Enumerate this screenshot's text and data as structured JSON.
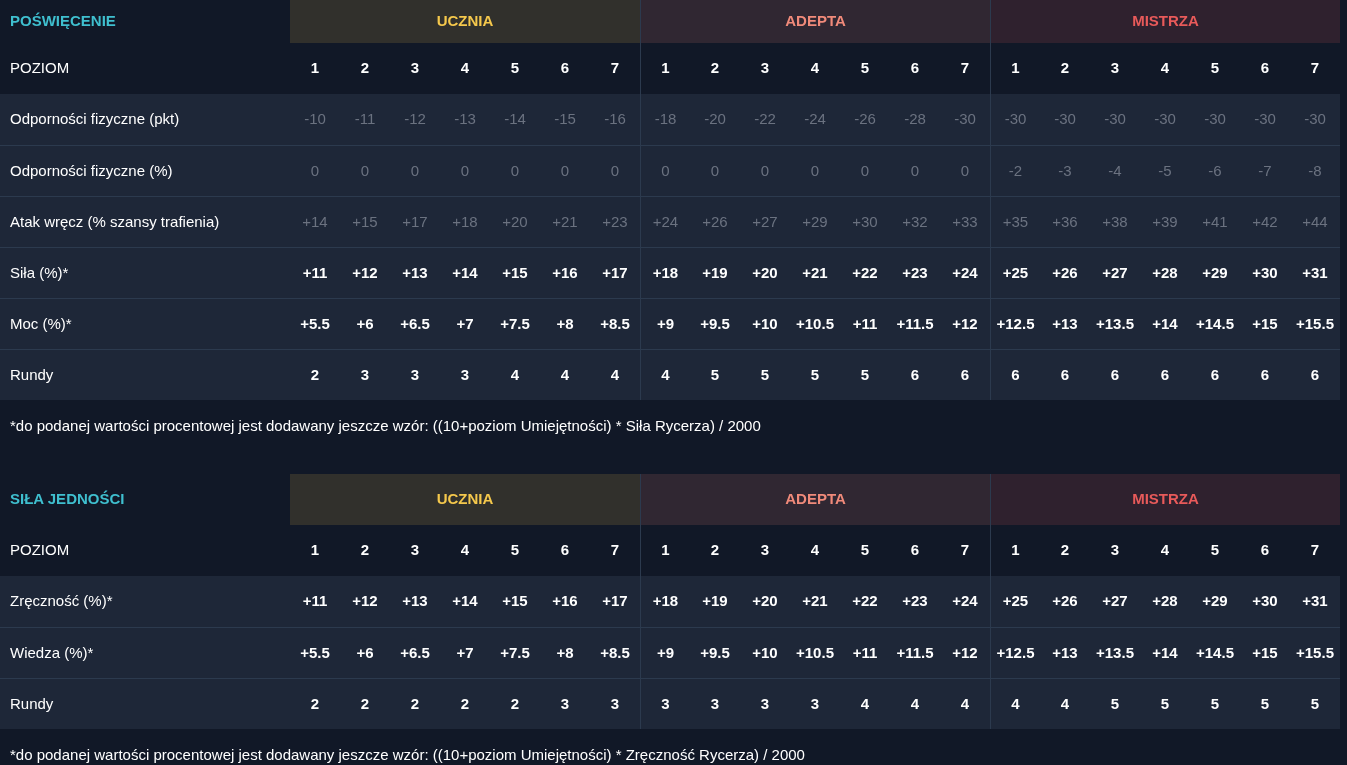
{
  "sections": [
    {
      "title": "POŚWIĘCENIE",
      "level_label": "POZIOM",
      "tiers": [
        {
          "name": "UCZNIA",
          "color": "#f5c84c",
          "levels": [
            "1",
            "2",
            "3",
            "4",
            "5",
            "6",
            "7"
          ]
        },
        {
          "name": "ADEPTA",
          "color": "#f08a7a",
          "levels": [
            "1",
            "2",
            "3",
            "4",
            "5",
            "6",
            "7"
          ]
        },
        {
          "name": "MISTRZA",
          "color": "#e85a5a",
          "levels": [
            "1",
            "2",
            "3",
            "4",
            "5",
            "6",
            "7"
          ]
        }
      ],
      "rows": [
        {
          "label": "Odporności fizyczne (pkt)",
          "dimmed": true,
          "values": [
            "-10",
            "-11",
            "-12",
            "-13",
            "-14",
            "-15",
            "-16",
            "-18",
            "-20",
            "-22",
            "-24",
            "-26",
            "-28",
            "-30",
            "-30",
            "-30",
            "-30",
            "-30",
            "-30",
            "-30",
            "-30"
          ]
        },
        {
          "label": "Odporności fizyczne (%)",
          "dimmed": true,
          "values": [
            "0",
            "0",
            "0",
            "0",
            "0",
            "0",
            "0",
            "0",
            "0",
            "0",
            "0",
            "0",
            "0",
            "0",
            "-2",
            "-3",
            "-4",
            "-5",
            "-6",
            "-7",
            "-8"
          ]
        },
        {
          "label": "Atak wręcz (% szansy trafienia)",
          "dimmed": true,
          "values": [
            "+14",
            "+15",
            "+17",
            "+18",
            "+20",
            "+21",
            "+23",
            "+24",
            "+26",
            "+27",
            "+29",
            "+30",
            "+32",
            "+33",
            "+35",
            "+36",
            "+38",
            "+39",
            "+41",
            "+42",
            "+44"
          ]
        },
        {
          "label": "Siła (%)*",
          "dimmed": false,
          "values": [
            "+11",
            "+12",
            "+13",
            "+14",
            "+15",
            "+16",
            "+17",
            "+18",
            "+19",
            "+20",
            "+21",
            "+22",
            "+23",
            "+24",
            "+25",
            "+26",
            "+27",
            "+28",
            "+29",
            "+30",
            "+31"
          ]
        },
        {
          "label": "Moc (%)*",
          "dimmed": false,
          "values": [
            "+5.5",
            "+6",
            "+6.5",
            "+7",
            "+7.5",
            "+8",
            "+8.5",
            "+9",
            "+9.5",
            "+10",
            "+10.5",
            "+11",
            "+11.5",
            "+12",
            "+12.5",
            "+13",
            "+13.5",
            "+14",
            "+14.5",
            "+15",
            "+15.5"
          ]
        },
        {
          "label": "Rundy",
          "dimmed": false,
          "values": [
            "2",
            "3",
            "3",
            "3",
            "4",
            "4",
            "4",
            "4",
            "5",
            "5",
            "5",
            "5",
            "6",
            "6",
            "6",
            "6",
            "6",
            "6",
            "6",
            "6",
            "6"
          ]
        }
      ],
      "footnote": "*do podanej wartości procentowej jest dodawany jeszcze wzór: ((10+poziom Umiejętności) * Siła Rycerza) / 2000"
    },
    {
      "title": "SIŁA JEDNOŚCI",
      "level_label": "POZIOM",
      "tiers": [
        {
          "name": "UCZNIA",
          "color": "#f5c84c",
          "levels": [
            "1",
            "2",
            "3",
            "4",
            "5",
            "6",
            "7"
          ]
        },
        {
          "name": "ADEPTA",
          "color": "#f08a7a",
          "levels": [
            "1",
            "2",
            "3",
            "4",
            "5",
            "6",
            "7"
          ]
        },
        {
          "name": "MISTRZA",
          "color": "#e85a5a",
          "levels": [
            "1",
            "2",
            "3",
            "4",
            "5",
            "6",
            "7"
          ]
        }
      ],
      "rows": [
        {
          "label": "Zręczność (%)*",
          "dimmed": false,
          "values": [
            "+11",
            "+12",
            "+13",
            "+14",
            "+15",
            "+16",
            "+17",
            "+18",
            "+19",
            "+20",
            "+21",
            "+22",
            "+23",
            "+24",
            "+25",
            "+26",
            "+27",
            "+28",
            "+29",
            "+30",
            "+31"
          ]
        },
        {
          "label": "Wiedza (%)*",
          "dimmed": false,
          "values": [
            "+5.5",
            "+6",
            "+6.5",
            "+7",
            "+7.5",
            "+8",
            "+8.5",
            "+9",
            "+9.5",
            "+10",
            "+10.5",
            "+11",
            "+11.5",
            "+12",
            "+12.5",
            "+13",
            "+13.5",
            "+14",
            "+14.5",
            "+15",
            "+15.5"
          ]
        },
        {
          "label": "Rundy",
          "dimmed": false,
          "values": [
            "2",
            "2",
            "2",
            "2",
            "2",
            "3",
            "3",
            "3",
            "3",
            "3",
            "3",
            "4",
            "4",
            "4",
            "4",
            "4",
            "5",
            "5",
            "5",
            "5",
            "5"
          ]
        }
      ],
      "footnote": "*do podanej wartości procentowej jest dodawany jeszcze wzór: ((10+poziom Umiejętności) * Zręczność Rycerza) / 2000"
    }
  ]
}
